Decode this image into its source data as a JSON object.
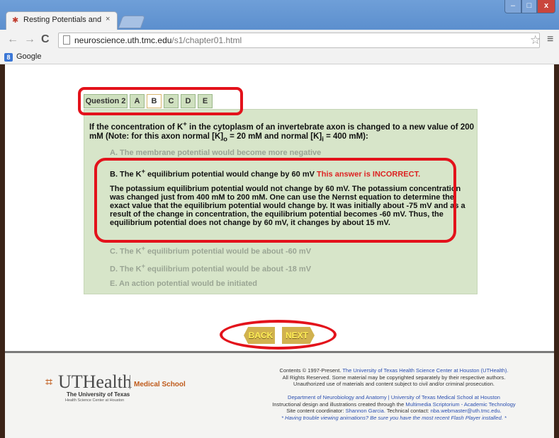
{
  "browser": {
    "tab_title": "Resting Potentials and Act",
    "tab_close": "×",
    "url_host": "neuroscience.uth.tmc.edu",
    "url_path": "/s1/chapter01.html",
    "bookmark_label": "Google",
    "window_buttons": {
      "minimize": "–",
      "maximize": "□",
      "close": "x"
    }
  },
  "quiz": {
    "tabs": [
      {
        "label": "Question 2"
      },
      {
        "label": "A"
      },
      {
        "label": "B"
      },
      {
        "label": "C"
      },
      {
        "label": "D"
      },
      {
        "label": "E"
      }
    ],
    "selected_tab": "B",
    "question_part1": "If the concentration of K",
    "question_part2": " in the cytoplasm of an invertebrate axon is changed to a new value of 200 mM (Note: for this axon normal [K]",
    "question_part3": " = 20 mM and normal [K]",
    "question_part4": " = 400 mM):",
    "option_a": "A. The membrane potential would become more negative",
    "option_b_prefix": "B. The K",
    "option_b_suffix": " equilibrium potential would change by 60 mV",
    "option_b_result": "This answer is INCORRECT.",
    "option_b_explanation": "The potassium equilibrium potential would not change by 60 mV. The potassium concentration was changed just from 400 mM to 200 mM. One can use the Nernst equation to determine the exact value that the equilibrium potential would change by. It was initially about -75 mV and as a result of the change in concentration, the equilibrium potential becomes -60 mV. Thus, the equilibrium potential does not change by 60 mV, it changes by about 15 mV.",
    "option_c_prefix": "C. The K",
    "option_c_suffix": " equilibrium potential would be about -60 mV",
    "option_d_prefix": "D. The K",
    "option_d_suffix": " equilibrium potential would be about -18 mV",
    "option_e": "E. An action potential would be initiated",
    "superscript_plus": "+",
    "sub_o": "o",
    "sub_i": "i"
  },
  "navigation": {
    "back_label": "BACK",
    "next_label": "NEXT"
  },
  "footer": {
    "logo_main": "UTHealth",
    "logo_school": "Medical School",
    "logo_university": "The University of Texas",
    "logo_center": "Health Science Center at Houston",
    "contents_prefix": "Contents © 1997-Present.",
    "contents_link": "The University of Texas Health Science Center at Houston (UTHealth).",
    "rights_line": "All Rights Reserved. Some material may be copyrighted separately by their respective authors.",
    "unauthorized_line": "Unauthorized use of materials and content subject to civil and/or criminal prosecution.",
    "dept_line": "Department of Neurobiology and Anatomy | University of Texas Medical School at Houston",
    "instructional_prefix": "Instructional design and illustrations created through the",
    "instructional_link": "Multimedia Scriptorium - Academic Technology",
    "site_coordinator_prefix": "Site content coordinator:",
    "site_coordinator_name": "Shannon Garcia.",
    "technical_contact_prefix": "Technical contact:",
    "technical_contact_email": "nba.webmaster@uth.tmc.edu.",
    "flash_note": "* Having trouble viewing animations? Be sure you have the most recent Flash Player installed. *"
  },
  "colors": {
    "annotation": "#e3121b",
    "panel": "#d7e5c9",
    "incorrect": "#dd2222",
    "nav_button": "#d1b24f",
    "page_border": "#3b2418"
  }
}
